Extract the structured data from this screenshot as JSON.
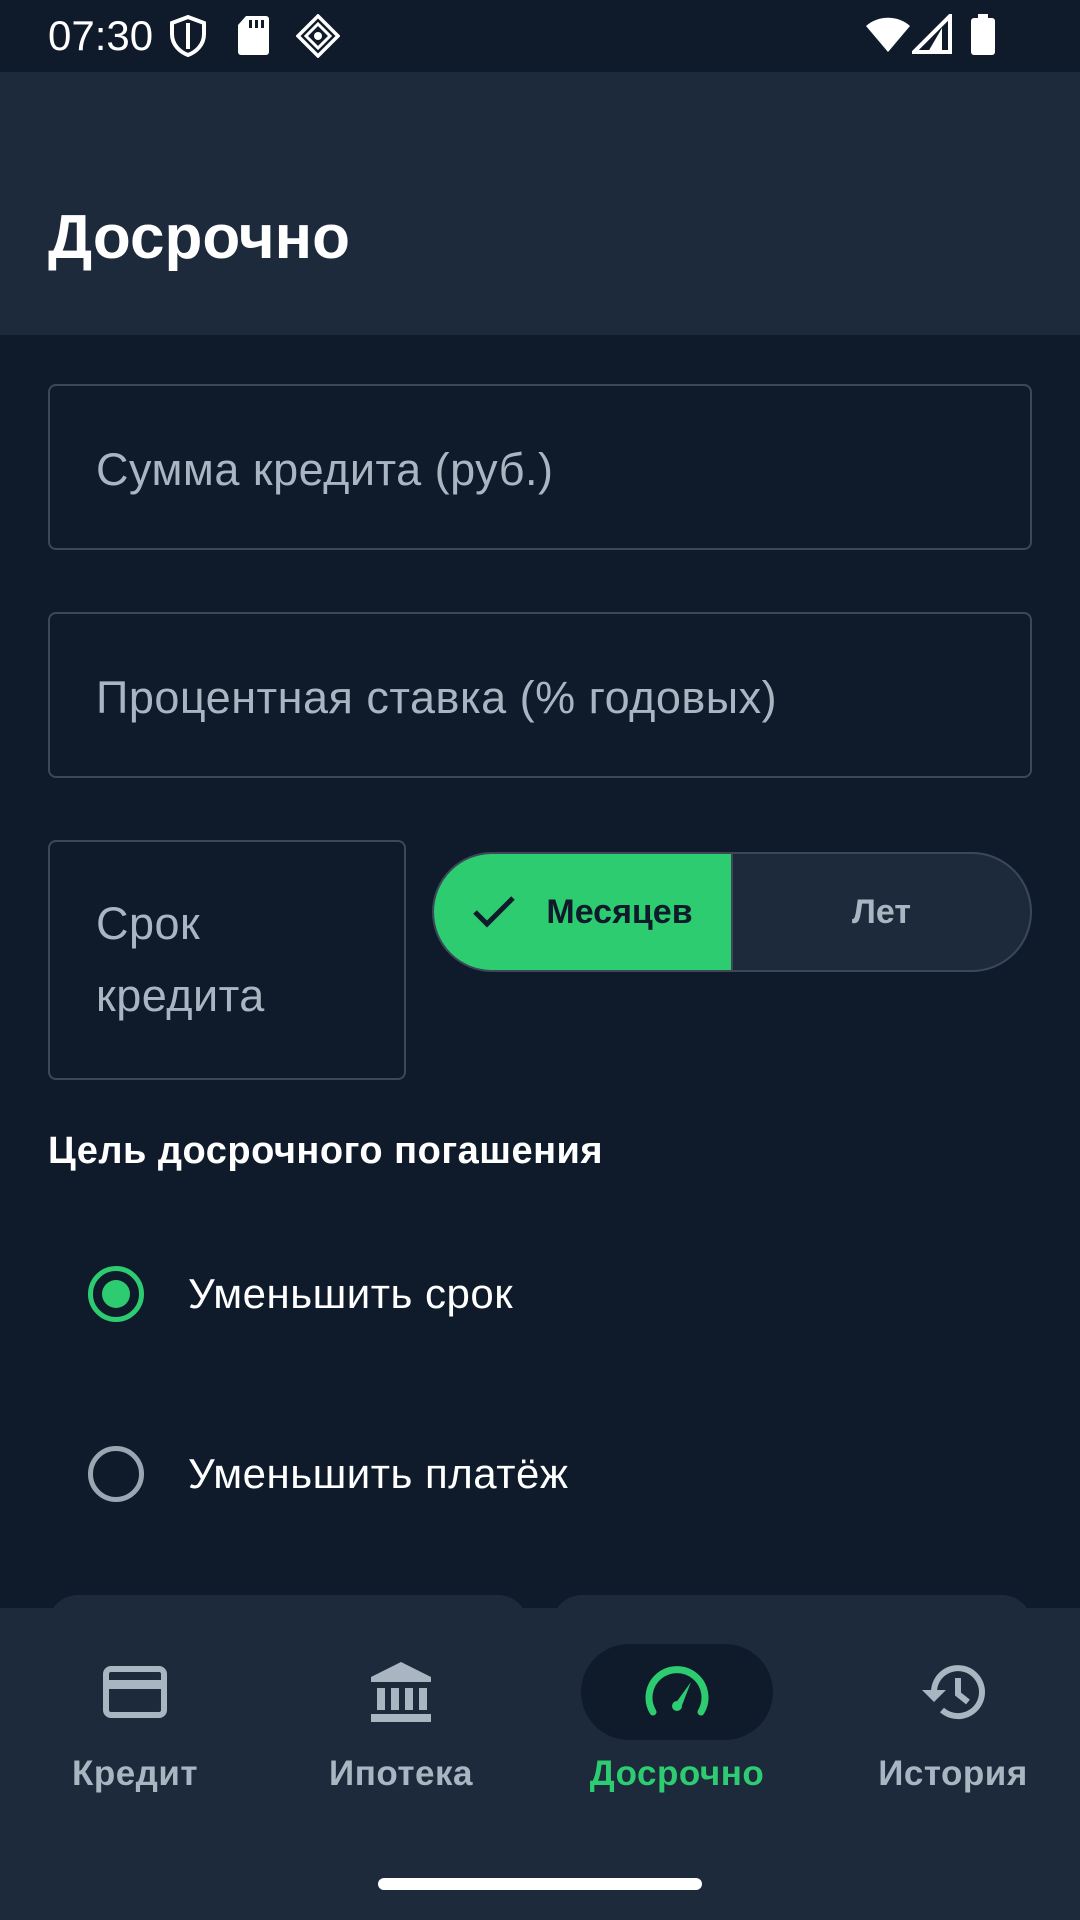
{
  "status_bar": {
    "time": "07:30",
    "icons_left": [
      "shield-icon",
      "sd-card-icon",
      "network-pattern-icon"
    ],
    "icons_right": [
      "wifi-icon",
      "signal-icon",
      "battery-icon"
    ]
  },
  "app_bar": {
    "title": "Досрочно"
  },
  "form": {
    "amount_placeholder": "Сумма кредита (руб.)",
    "rate_placeholder": "Процентная ставка (% годовых)",
    "term_placeholder_line1": "Срок",
    "term_placeholder_line2": "кредита",
    "term_unit": {
      "options": [
        "Месяцев",
        "Лет"
      ],
      "selected": "Месяцев"
    }
  },
  "goal": {
    "title": "Цель досрочного погашения",
    "options": [
      {
        "label": "Уменьшить срок",
        "selected": true
      },
      {
        "label": "Уменьшить платёж",
        "selected": false
      }
    ]
  },
  "bottom_nav": {
    "items": [
      {
        "label": "Кредит",
        "icon": "credit-card-icon",
        "active": false
      },
      {
        "label": "Ипотека",
        "icon": "bank-icon",
        "active": false
      },
      {
        "label": "Досрочно",
        "icon": "speedometer-icon",
        "active": true
      },
      {
        "label": "История",
        "icon": "history-icon",
        "active": false
      }
    ]
  },
  "colors": {
    "background": "#0f1b2b",
    "surface": "#1c2a3b",
    "accent": "#2ecc71",
    "muted_text": "#a9b6c2"
  }
}
